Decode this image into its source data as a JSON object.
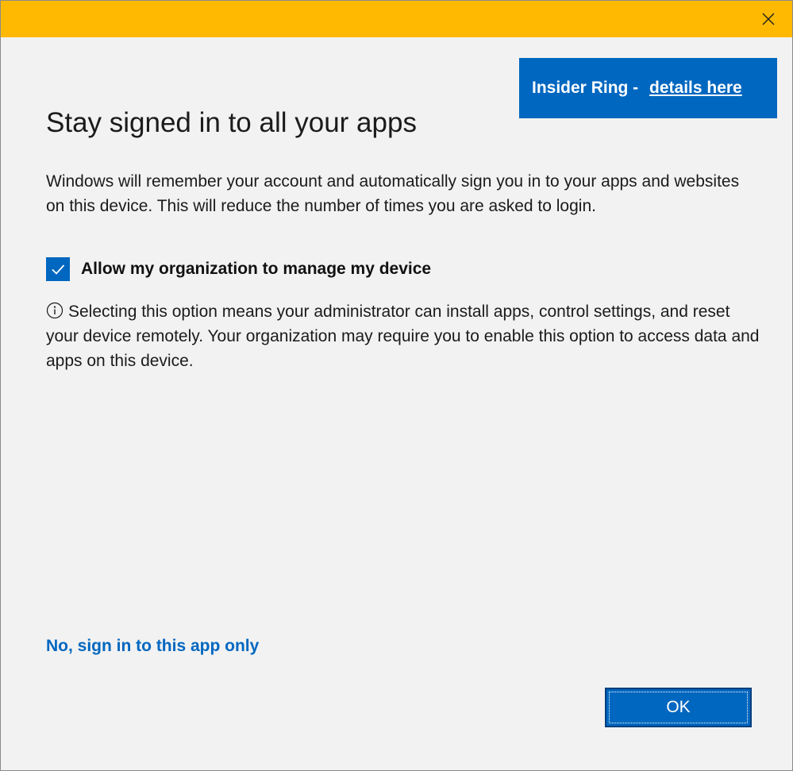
{
  "title_bar": {
    "accent_color": "#ffb900",
    "close_icon": "close-icon"
  },
  "banner": {
    "text": "Insider Ring - ",
    "link": "details here",
    "background_color": "#0067c0"
  },
  "heading": "Stay signed in to all your apps",
  "description": "Windows will remember your account and automatically sign you in to your apps and websites on this device. This will reduce the number of times you are asked to login.",
  "manage_device": {
    "checked": true,
    "label": "Allow my organization to manage my device",
    "info_icon": "info-icon",
    "info_text": "Selecting this option means your administrator can install apps, control settings, and reset your device remotely. Your organization may require you to enable this option to access data and apps on this device."
  },
  "alt_link": "No, sign in to this app only",
  "ok_button": "OK",
  "colors": {
    "accent": "#0067c0",
    "background": "#f2f2f2"
  }
}
